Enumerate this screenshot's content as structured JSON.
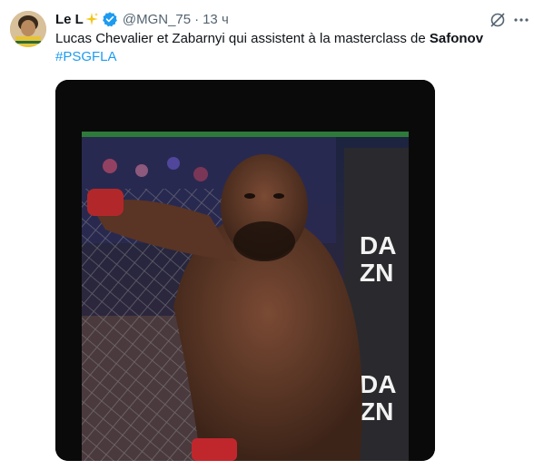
{
  "author": {
    "display_name": "Le L",
    "handle": "@MGN_75",
    "separator": "·",
    "time": "13 ч",
    "emoji_icon": "sparkles-icon",
    "verified_icon": "verified-badge-icon"
  },
  "tweet": {
    "text_plain": "Lucas Chevalier et Zabarnyi qui assistent à la masterclass de ",
    "text_bold": "Safonov",
    "hashtag": "#PSGFLA"
  },
  "media": {
    "banner_text_1": "DA",
    "banner_text_2": "ZN",
    "banner_text_3": "DA",
    "banner_text_4": "ZN"
  },
  "colors": {
    "accent": "#1d9bf0",
    "text": "#0f1419",
    "muted": "#536471",
    "sparkle": "#f5c518"
  }
}
